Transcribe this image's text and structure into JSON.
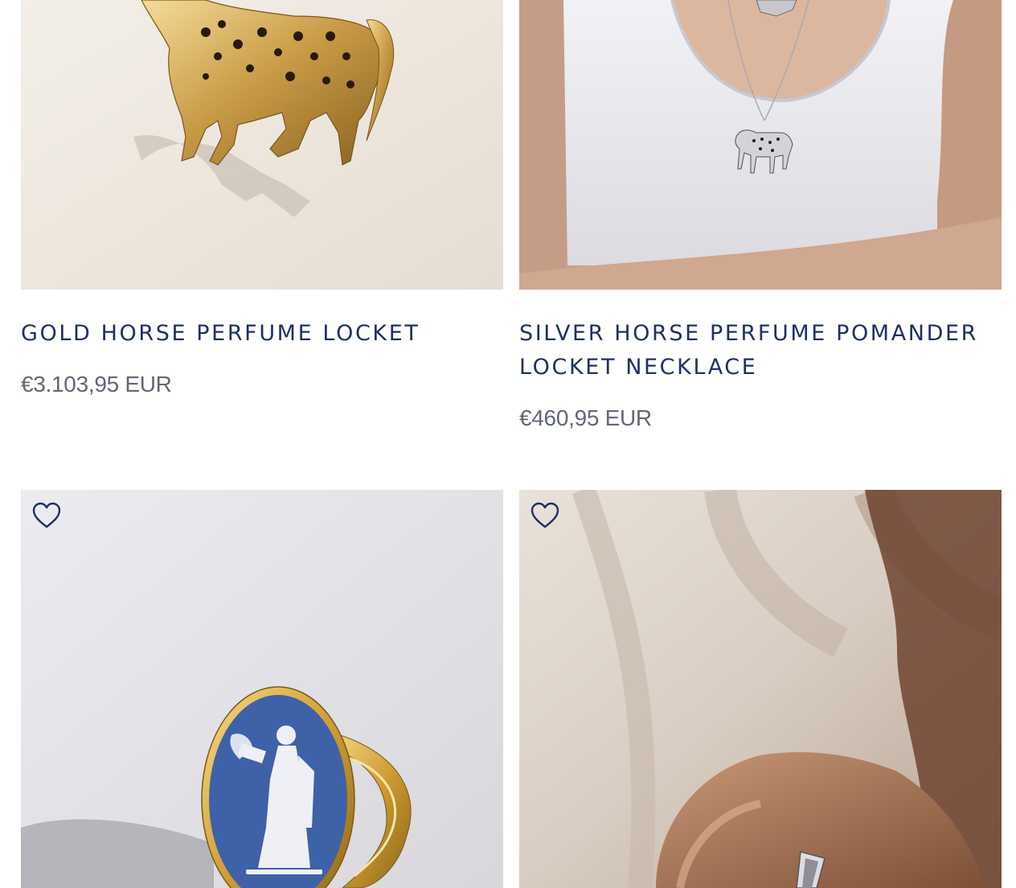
{
  "products": [
    {
      "title": "GOLD HORSE PERFUME LOCKET",
      "price": "€3.103,95 EUR",
      "image_alt": "gold spotted horse locket on beige background"
    },
    {
      "title_line1": "SILVER HORSE PERFUME POMANDER",
      "title_line2": "LOCKET NECKLACE",
      "price": "€460,95 EUR",
      "image_alt": "woman wearing silver horse locket necklace with white tank top"
    },
    {
      "image_alt": "gold ring with blue cameo of classical figure",
      "wishlist_icon": "heart-icon"
    },
    {
      "image_alt": "hand holding ring against beige fabric",
      "wishlist_icon": "heart-icon"
    }
  ],
  "colors": {
    "title": "#1f3163",
    "price": "#616776",
    "icon": "#1f3163"
  }
}
